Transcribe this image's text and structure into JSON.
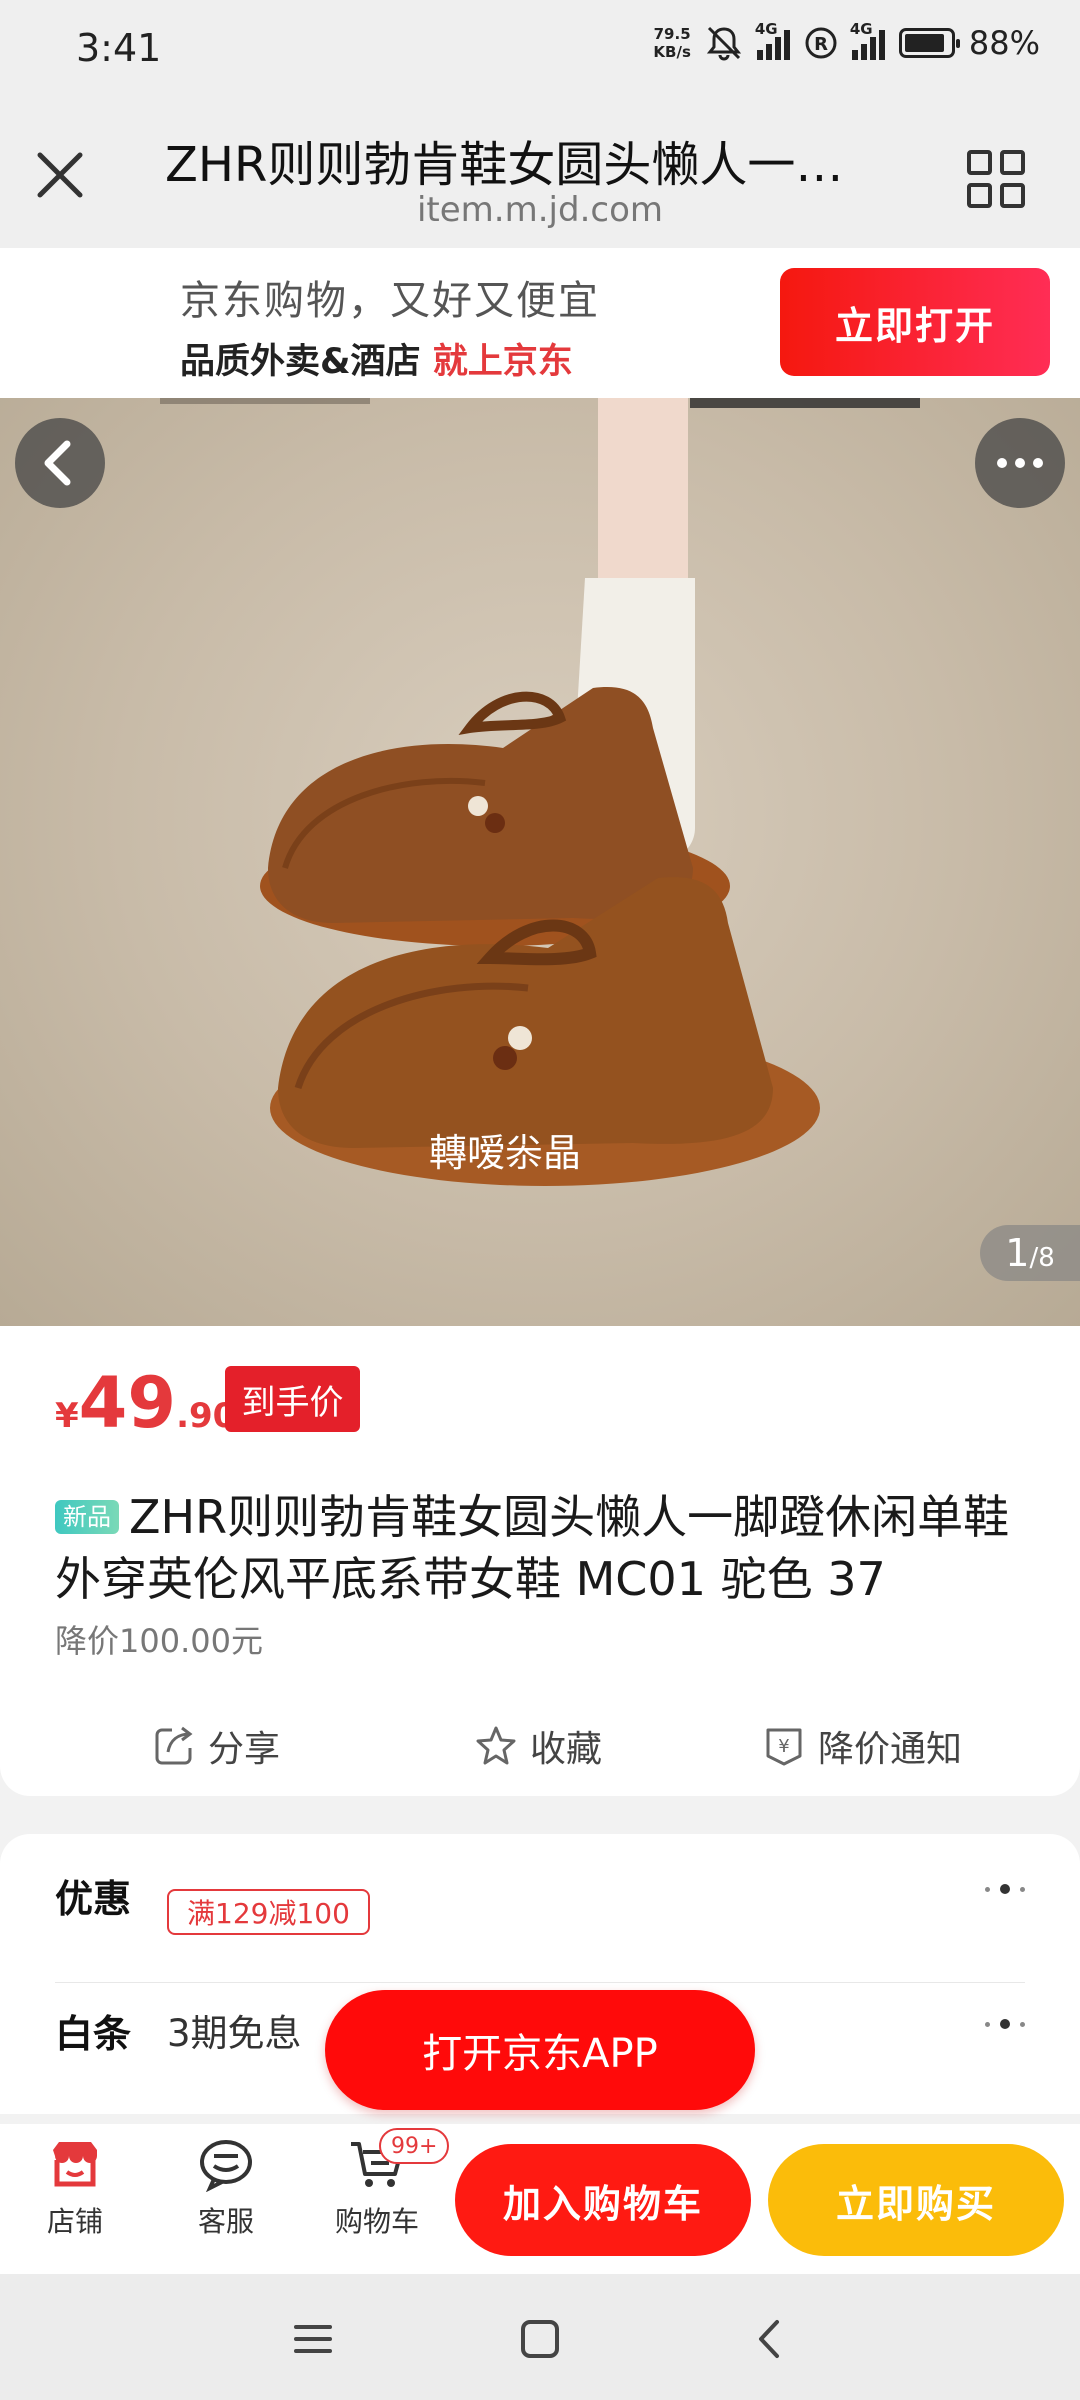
{
  "status_bar": {
    "time": "3:41",
    "net_speed_value": "79.5",
    "net_speed_unit": "KB/s",
    "network_tag_1": "4G",
    "network_tag_2": "4G",
    "battery_level": 0.88,
    "battery_percent": "88%"
  },
  "browser": {
    "title": "ZHR则则勃肯鞋女圆头懒人一…",
    "url": "item.m.jd.com"
  },
  "app_banner": {
    "line1": "京东购物，又好又便宜",
    "line2_prefix": "品质外卖&酒店 ",
    "line2_highlight": "就上京东",
    "open_button": "立即打开"
  },
  "gallery": {
    "watermark": "轉嗳尜晶",
    "current": "1",
    "total": "/8"
  },
  "product": {
    "price_symbol": "¥",
    "price_int": "49",
    "price_dec": ".90",
    "price_tag": "到手价",
    "new_badge": "新品",
    "title": "ZHR则则勃肯鞋女圆头懒人一脚蹬休闲单鞋外穿英伦风平底系带女鞋 MC01 驼色 37",
    "price_drop": "降价100.00元",
    "actions": {
      "share": "分享",
      "favorite": "收藏",
      "price_alert": "降价通知"
    }
  },
  "promotions": {
    "discount_label": "优惠",
    "coupon": "满129减100",
    "baitiao_label": "白条",
    "baitiao_value": "3期免息",
    "open_app_button": "打开京东APP"
  },
  "bottom_bar": {
    "shop": "店铺",
    "service": "客服",
    "cart": "购物车",
    "cart_badge": "99+",
    "add_to_cart": "加入购物车",
    "buy_now": "立即购买"
  },
  "colors": {
    "jd_red": "#e4393c",
    "buy_yellow": "#fbbc0a",
    "open_app_red": "#ff0a0a"
  }
}
